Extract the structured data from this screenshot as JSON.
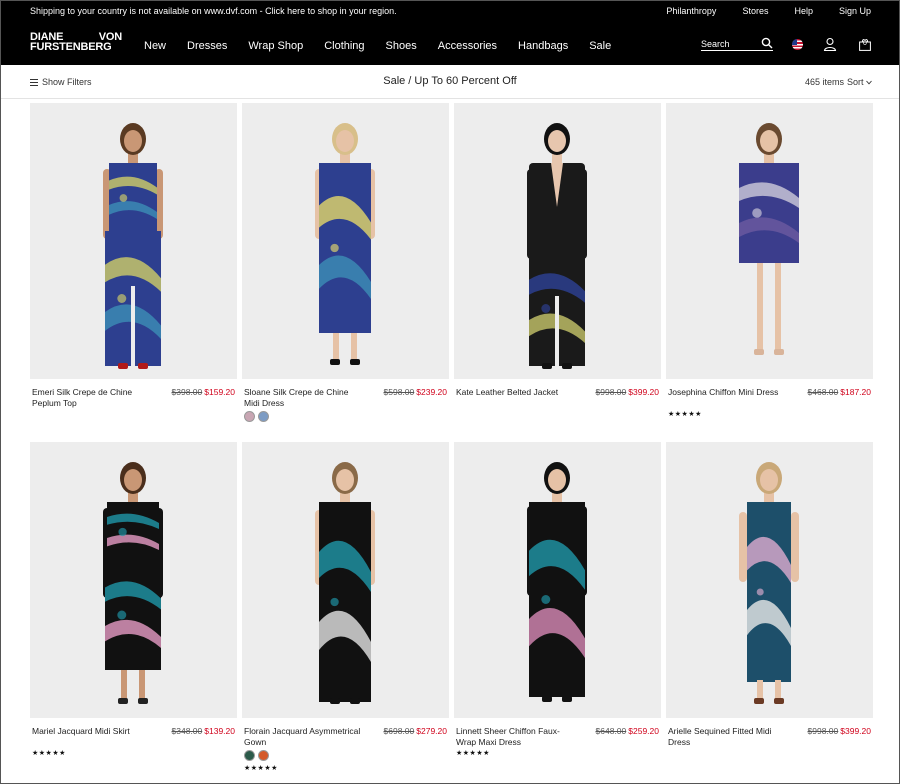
{
  "utility": {
    "shipping_notice": "Shipping to your country is not available on www.dvf.com - Click here to shop in your region.",
    "links": [
      "Philanthropy",
      "Stores",
      "Help",
      "Sign Up"
    ]
  },
  "brand": {
    "line1a": "DIANE",
    "line1b": "VON",
    "line2": "FURSTENBERG"
  },
  "nav": {
    "items": [
      "New",
      "Dresses",
      "Wrap Shop",
      "Clothing",
      "Shoes",
      "Accessories",
      "Handbags",
      "Sale"
    ]
  },
  "search": {
    "placeholder": "Search"
  },
  "cart": {
    "count": "0"
  },
  "filterbar": {
    "show_filters": "Show Filters",
    "title": "Sale / Up To 60 Percent Off",
    "items_count": "465 items",
    "sort_label": "Sort"
  },
  "products": [
    {
      "name": "Emeri Silk Crepe de Chine Peplum Top",
      "old_price": "$398.00",
      "sale_price": "$159.20",
      "stars": "",
      "swatches": [],
      "garment": "pants",
      "colors": [
        "#2d3f8f",
        "#c7c66a",
        "#3c8fb5"
      ],
      "shoes": "#b01a1a",
      "hair": "#5a3a22",
      "skin": "#c99775"
    },
    {
      "name": "Sloane Silk Crepe de Chine Midi Dress",
      "old_price": "$598.00",
      "sale_price": "$239.20",
      "stars": "",
      "swatches": [
        "#c8a6b3",
        "#7d9cc4"
      ],
      "garment": "midi",
      "colors": [
        "#2d3f8f",
        "#d9cf6c",
        "#3c8fb5"
      ],
      "shoes": "#111111",
      "hair": "#d8bf8a",
      "skin": "#e6c2a6"
    },
    {
      "name": "Kate Leather Belted Jacket",
      "old_price": "$998.00",
      "sale_price": "$399.20",
      "stars": "",
      "swatches": [],
      "garment": "jacket",
      "colors": [
        "#1a1a1a",
        "#2d3f8f",
        "#c7c66a"
      ],
      "shoes": "#111111",
      "hair": "#111111",
      "skin": "#e7c6ae"
    },
    {
      "name": "Josephina Chiffon Mini Dress",
      "old_price": "$468.00",
      "sale_price": "$187.20",
      "stars": "★★★★★",
      "swatches": [],
      "garment": "mini",
      "colors": [
        "#3b3d8c",
        "#c7c3d6",
        "#6d5aa0"
      ],
      "shoes": "#d9b49a",
      "hair": "#6a4a30",
      "skin": "#e6c2a6"
    },
    {
      "name": "Mariel Jacquard Midi Skirt",
      "old_price": "$348.00",
      "sale_price": "$139.20",
      "stars": "★★★★★",
      "swatches": [],
      "garment": "skirt",
      "colors": [
        "#111111",
        "#1e8fa0",
        "#e79cc6"
      ],
      "shoes": "#222222",
      "hair": "#4a2e1c",
      "skin": "#c99775"
    },
    {
      "name": "Florain Jacquard Asymmetrical Gown",
      "old_price": "$698.00",
      "sale_price": "$279.20",
      "stars": "★★★★★",
      "swatches": [
        "#2b5a4a",
        "#d45a2a"
      ],
      "garment": "gown",
      "colors": [
        "#111111",
        "#1e8fa0",
        "#e5e5e5"
      ],
      "shoes": "#111111",
      "hair": "#8a6a48",
      "skin": "#e6c2a6"
    },
    {
      "name": "Linnett Sheer Chiffon Faux-Wrap Maxi Dress",
      "old_price": "$648.00",
      "sale_price": "$259.20",
      "stars": "★★★★★",
      "swatches": [],
      "garment": "maxi",
      "colors": [
        "#111111",
        "#1e8fa0",
        "#d88ab7"
      ],
      "shoes": "#111111",
      "hair": "#111111",
      "skin": "#e6c2a6"
    },
    {
      "name": "Arielle Sequined Fitted Midi Dress",
      "old_price": "$998.00",
      "sale_price": "$399.20",
      "stars": "",
      "swatches": [],
      "garment": "sheath",
      "colors": [
        "#1d4f6a",
        "#d2a6c9",
        "#e9e9e9"
      ],
      "shoes": "#6b3a24",
      "hair": "#c9a878",
      "skin": "#e6c2a6"
    }
  ]
}
